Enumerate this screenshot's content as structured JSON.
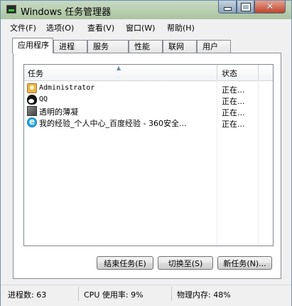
{
  "window": {
    "title": "Windows 任务管理器"
  },
  "menu": [
    "文件(F)",
    "选项(O)",
    "查看(V)",
    "窗口(W)",
    "帮助(H)"
  ],
  "tabs": [
    "应用程序",
    "进程",
    "服务",
    "性能",
    "联网",
    "用户"
  ],
  "active_tab": "应用程序",
  "table": {
    "columns": [
      "任务",
      "状态"
    ],
    "rows": [
      {
        "name": "Administrator",
        "status": "正在...",
        "icon": "user-folder-icon"
      },
      {
        "name": "QQ",
        "status": "正在...",
        "icon": "qq-penguin-icon"
      },
      {
        "name": "透明的薄凝",
        "status": "正在...",
        "icon": "photo-icon"
      },
      {
        "name": "我的经验_个人中心_百度经验 - 360安全...",
        "status": "正在...",
        "icon": "browser-icon"
      }
    ]
  },
  "buttons": {
    "end_task": "结束任务(E)",
    "switch_to": "切换至(S)",
    "new_task": "新任务(N)..."
  },
  "status": {
    "processes": "进程数: 63",
    "cpu": "CPU 使用率: 9%",
    "memory": "物理内存: 48%"
  }
}
